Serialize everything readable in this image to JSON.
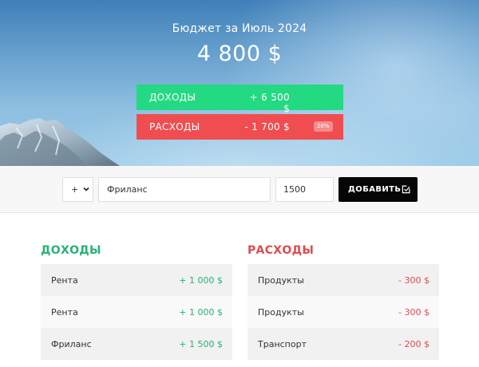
{
  "header": {
    "budget_title": "Бюджет за Июль 2024",
    "total": "4 800 $"
  },
  "summary": {
    "income_label": "ДОХОДЫ",
    "income_value": "+ 6 500 $",
    "expense_label": "РАСХОДЫ",
    "expense_value": "- 1 700 $",
    "expense_percent": "26%"
  },
  "form": {
    "type_value": "+",
    "description_value": "Фриланс",
    "amount_value": "1500",
    "add_label": "ДОБАВИТЬ"
  },
  "income": {
    "title": "ДОХОДЫ",
    "items": [
      {
        "name": "Рента",
        "amount": "+ 1 000 $"
      },
      {
        "name": "Рента",
        "amount": "+ 1 000 $"
      },
      {
        "name": "Фриланс",
        "amount": "+ 1 500 $"
      }
    ]
  },
  "expenses": {
    "title": "РАСХОДЫ",
    "items": [
      {
        "name": "Продукты",
        "amount": "- 300 $"
      },
      {
        "name": "Продукты",
        "amount": "- 300 $"
      },
      {
        "name": "Транспорт",
        "amount": "- 200 $"
      }
    ]
  },
  "colors": {
    "income": "#23d982",
    "expense": "#f04d50",
    "income_text": "#27b374",
    "expense_text": "#e14c50",
    "button": "#060606"
  },
  "icons": {
    "select_chevron": "chevron-down-icon",
    "add_button_icon": "checkbox-edit-icon"
  }
}
